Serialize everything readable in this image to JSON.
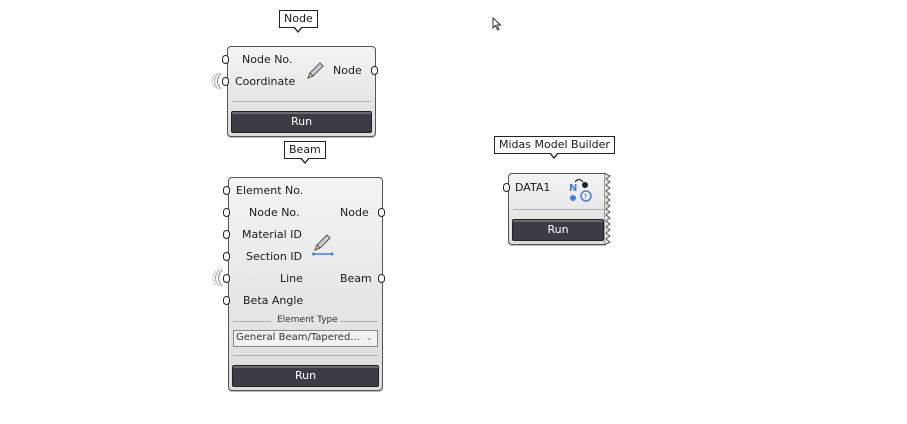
{
  "node_component": {
    "tag": "Node",
    "inputs": [
      "Node No.",
      "Coordinate"
    ],
    "outputs": [
      "Node"
    ],
    "run_label": "Run",
    "icon": "pencil-icon"
  },
  "beam_component": {
    "tag": "Beam",
    "inputs": [
      "Element No.",
      "Node No.",
      "Material ID",
      "Section ID",
      "Line",
      "Beta Angle"
    ],
    "outputs": [
      "Node",
      "Beam"
    ],
    "group_label": "Element Type",
    "element_type_value": "General Beam/Tapered...",
    "run_label": "Run",
    "icon": "pencil-line-icon"
  },
  "builder_component": {
    "tag": "Midas Model Builder",
    "inputs": [
      "DATA1"
    ],
    "run_label": "Run",
    "icon": "node-graph-icon"
  }
}
